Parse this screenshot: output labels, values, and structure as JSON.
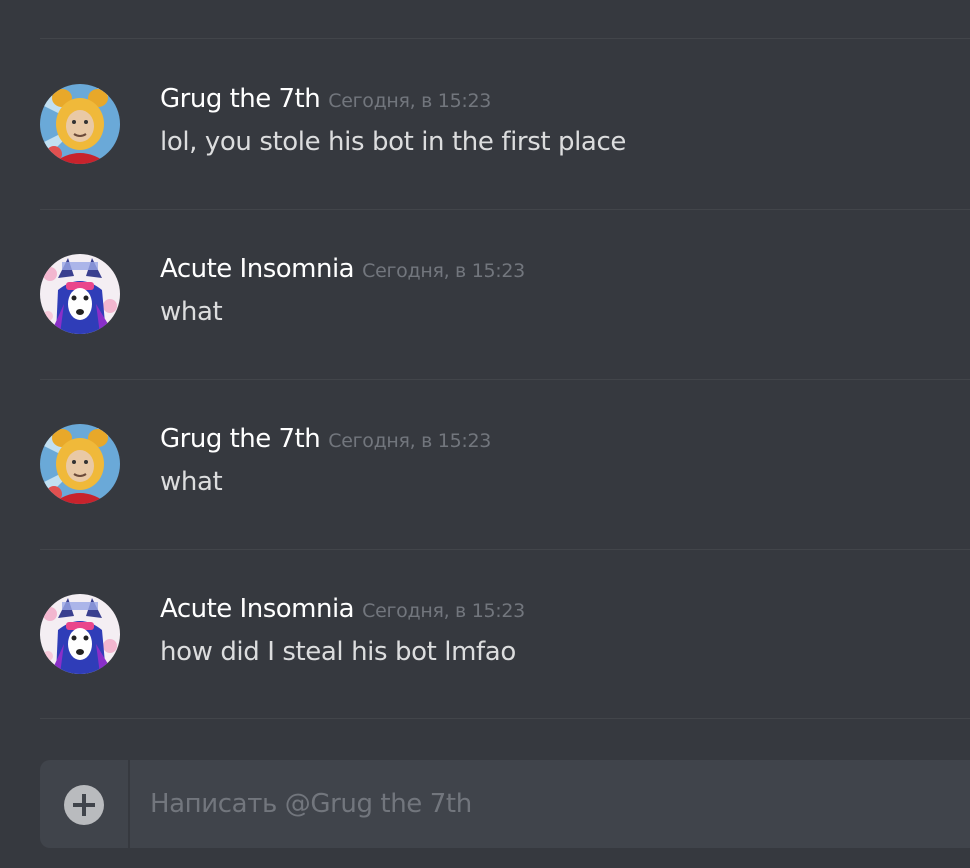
{
  "messages": [
    {
      "author": "Grug the 7th",
      "timestamp": "Сегодня, в 15:23",
      "content": "lol, you stole his bot in the first place",
      "avatar_icon": "pooh-avatar"
    },
    {
      "author": "Acute Insomnia",
      "timestamp": "Сегодня, в 15:23",
      "content": "what",
      "avatar_icon": "wolf-anime-avatar"
    },
    {
      "author": "Grug the 7th",
      "timestamp": "Сегодня, в 15:23",
      "content": "what",
      "avatar_icon": "pooh-avatar"
    },
    {
      "author": "Acute Insomnia",
      "timestamp": "Сегодня, в 15:23",
      "content": "how did I steal his bot lmfao",
      "avatar_icon": "wolf-anime-avatar"
    }
  ],
  "composer": {
    "placeholder": "Написать @Grug the 7th",
    "value": "",
    "attach_icon": "plus-circle-icon"
  },
  "colors": {
    "background": "#36393f",
    "divider": "#42454a",
    "author": "#ffffff",
    "timestamp": "#72767d",
    "content": "#dcddde",
    "composer": "#40444b"
  }
}
